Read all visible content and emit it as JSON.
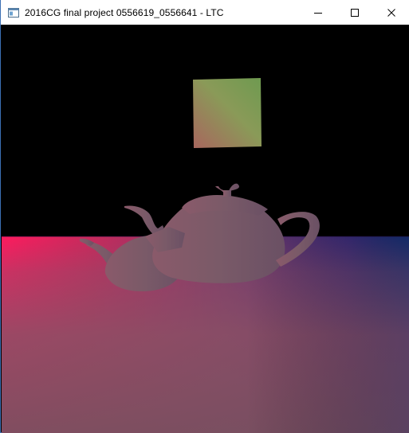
{
  "window": {
    "title": "2016CG final project 0556619_0556641 - LTC"
  },
  "titlebar": {
    "icons": [
      "app-window-icon",
      "minimize-icon",
      "maximize-icon",
      "close-icon"
    ]
  },
  "colors": {
    "background": "#000000",
    "floor_left": "#e8175a",
    "floor_right": "#0a1f6e",
    "floor_near": "#8a5066",
    "teapot": "#7a5a66",
    "light_quad_top": "#8aa055",
    "light_quad_bottom": "#a06a60"
  }
}
